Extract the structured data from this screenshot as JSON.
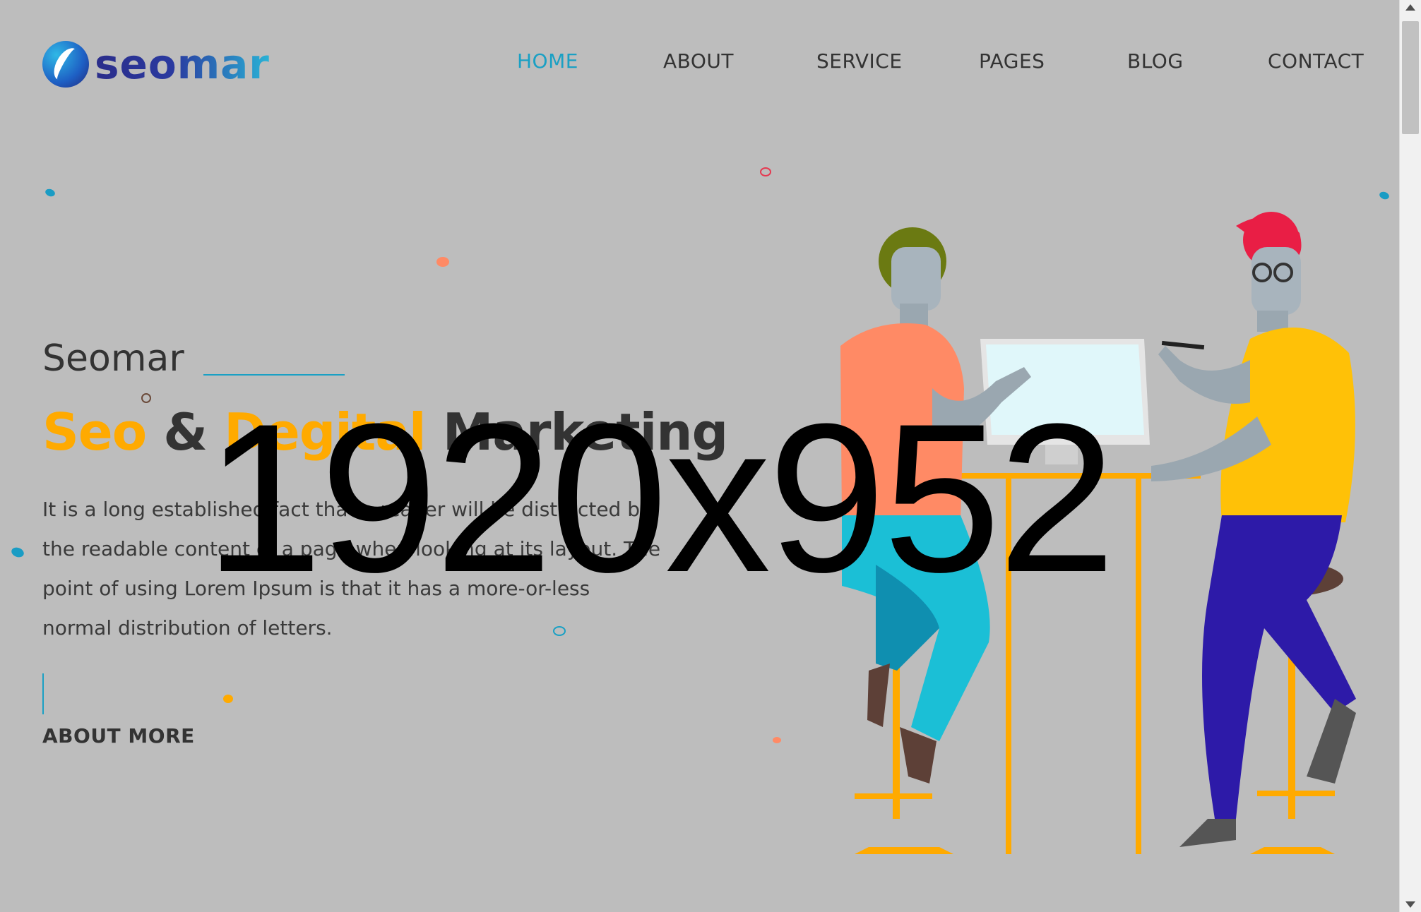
{
  "brand": {
    "name": "seomar",
    "logo_icon": "seomar-logo-icon"
  },
  "nav": {
    "items": [
      {
        "label": "HOME",
        "active": true
      },
      {
        "label": "ABOUT",
        "active": false
      },
      {
        "label": "SERVICE",
        "active": false
      },
      {
        "label": "PAGES",
        "active": false
      },
      {
        "label": "BLOG",
        "active": false
      },
      {
        "label": "CONTACT",
        "active": false
      }
    ]
  },
  "hero": {
    "eyebrow": "Seomar",
    "title": {
      "part1": "Seo",
      "amp": "&",
      "part2": "Degital",
      "part3": "Marketing"
    },
    "description": "It is a long established fact that a reader will be distracted by the readable content of a page when looking at its layout. The point of using Lorem Ipsum is that it has a more-or-less normal distribution of letters.",
    "cta_label": "ABOUT MORE"
  },
  "placeholder": {
    "text": "1920x952"
  },
  "colors": {
    "background": "#bdbdbd",
    "accent": "#1aa0c4",
    "highlight": "#ffaa00",
    "text": "#333333"
  },
  "illustration": {
    "icon": "two-people-at-computer-illustration"
  }
}
